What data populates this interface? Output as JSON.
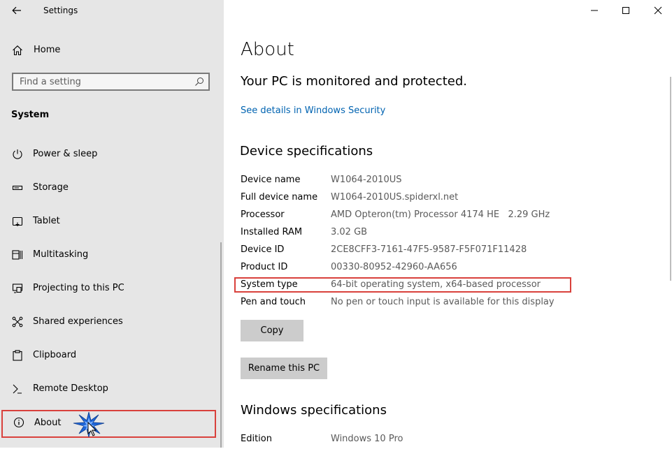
{
  "window": {
    "app_title": "Settings"
  },
  "sidebar": {
    "home_label": "Home",
    "search_placeholder": "Find a setting",
    "section_label": "System",
    "items": [
      {
        "label": "Power & sleep",
        "icon": "power-icon"
      },
      {
        "label": "Storage",
        "icon": "storage-icon"
      },
      {
        "label": "Tablet",
        "icon": "tablet-icon"
      },
      {
        "label": "Multitasking",
        "icon": "multitasking-icon"
      },
      {
        "label": "Projecting to this PC",
        "icon": "projecting-icon"
      },
      {
        "label": "Shared experiences",
        "icon": "shared-experiences-icon"
      },
      {
        "label": "Clipboard",
        "icon": "clipboard-icon"
      },
      {
        "label": "Remote Desktop",
        "icon": "remote-desktop-icon"
      },
      {
        "label": "About",
        "icon": "info-icon",
        "selected": true
      }
    ]
  },
  "main": {
    "title": "About",
    "protection_message": "Your PC is monitored and protected.",
    "security_link": "See details in Windows Security",
    "device_specs": {
      "heading": "Device specifications",
      "rows": [
        {
          "key": "Device name",
          "value": "W1064-2010US"
        },
        {
          "key": "Full device name",
          "value": "W1064-2010US.spiderxl.net"
        },
        {
          "key": "Processor",
          "value": "AMD Opteron(tm) Processor 4174 HE   2.29 GHz"
        },
        {
          "key": "Installed RAM",
          "value": "3.02 GB"
        },
        {
          "key": "Device ID",
          "value": "2CE8CFF3-7161-47F5-9587-F5F071F11428"
        },
        {
          "key": "Product ID",
          "value": "00330-80952-42960-AA656"
        },
        {
          "key": "System type",
          "value": "64-bit operating system, x64-based processor",
          "highlighted": true
        },
        {
          "key": "Pen and touch",
          "value": "No pen or touch input is available for this display"
        }
      ],
      "copy_button": "Copy",
      "rename_button": "Rename this PC"
    },
    "windows_specs": {
      "heading": "Windows specifications",
      "rows": [
        {
          "key": "Edition",
          "value": "Windows 10 Pro"
        }
      ]
    }
  },
  "colors": {
    "sidebar_bg": "#e6e6e6",
    "link": "#0063b1",
    "highlight": "#d9413c",
    "button_bg": "#cccccc"
  }
}
